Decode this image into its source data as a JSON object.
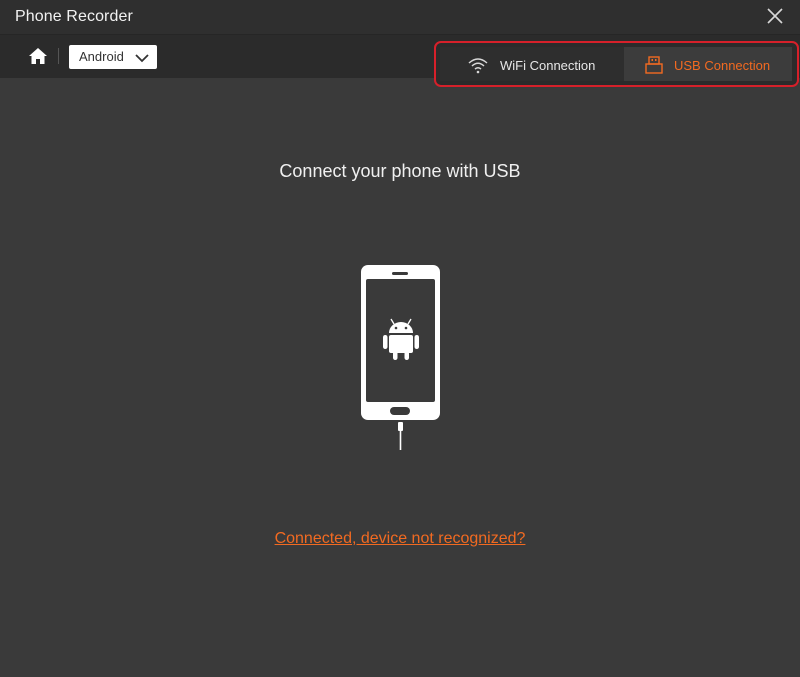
{
  "window": {
    "title": "Phone Recorder",
    "close_icon": "close-icon"
  },
  "toolbar": {
    "home_icon": "home-icon",
    "os_select": {
      "selected": "Android",
      "chevron_icon": "chevron-down-icon"
    },
    "connection_tabs": [
      {
        "label": "WiFi Connection",
        "icon": "wifi-icon",
        "active": false
      },
      {
        "label": "USB Connection",
        "icon": "usb-icon",
        "active": true
      }
    ]
  },
  "main": {
    "headline": "Connect your phone with USB",
    "illustration": "android-phone-usb-icon",
    "help_link": "Connected, device not recognized?"
  },
  "colors": {
    "accent": "#f26a21",
    "highlight_border": "#d6202a",
    "background": "#3a3a3a"
  }
}
